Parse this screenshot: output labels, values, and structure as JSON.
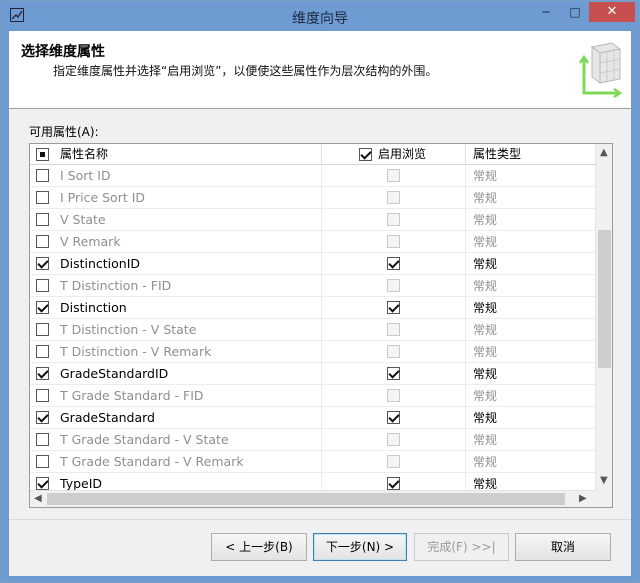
{
  "window": {
    "title": "维度向导",
    "min_glyph": "─",
    "max_glyph": "□",
    "close_glyph": "✕"
  },
  "header": {
    "title": "选择维度属性",
    "subtitle": "指定维度属性并选择“启用浏览”，以便使这些属性作为层次结构的外围。"
  },
  "list": {
    "label": "可用属性(A):",
    "columns": [
      "属性名称",
      "启用浏览",
      "属性类型"
    ],
    "rows": [
      {
        "name": "I Sort ID",
        "checked": false,
        "browse": false,
        "type": "常规"
      },
      {
        "name": "I Price Sort ID",
        "checked": false,
        "browse": false,
        "type": "常规"
      },
      {
        "name": "V State",
        "checked": false,
        "browse": false,
        "type": "常规"
      },
      {
        "name": "V Remark",
        "checked": false,
        "browse": false,
        "type": "常规"
      },
      {
        "name": "DistinctionID",
        "checked": true,
        "browse": true,
        "type": "常规"
      },
      {
        "name": "T Distinction - FID",
        "checked": false,
        "browse": false,
        "type": "常规"
      },
      {
        "name": "Distinction",
        "checked": true,
        "browse": true,
        "type": "常规"
      },
      {
        "name": "T Distinction - V State",
        "checked": false,
        "browse": false,
        "type": "常规"
      },
      {
        "name": "T Distinction - V Remark",
        "checked": false,
        "browse": false,
        "type": "常规"
      },
      {
        "name": "GradeStandardID",
        "checked": true,
        "browse": true,
        "type": "常规"
      },
      {
        "name": "T Grade Standard - FID",
        "checked": false,
        "browse": false,
        "type": "常规"
      },
      {
        "name": "GradeStandard",
        "checked": true,
        "browse": true,
        "type": "常规"
      },
      {
        "name": "T Grade Standard - V State",
        "checked": false,
        "browse": false,
        "type": "常规"
      },
      {
        "name": "T Grade Standard - V Remark",
        "checked": false,
        "browse": false,
        "type": "常规"
      },
      {
        "name": "TypeID",
        "checked": true,
        "browse": true,
        "type": "常规"
      }
    ]
  },
  "buttons": {
    "back": "< 上一步(B)",
    "next": "下一步(N) >",
    "finish": "完成(F) >>|",
    "cancel": "取消"
  },
  "colors": {
    "titlebar": "#6f9bd3",
    "close": "#c74f4f",
    "accent_green": "#7ed957"
  }
}
